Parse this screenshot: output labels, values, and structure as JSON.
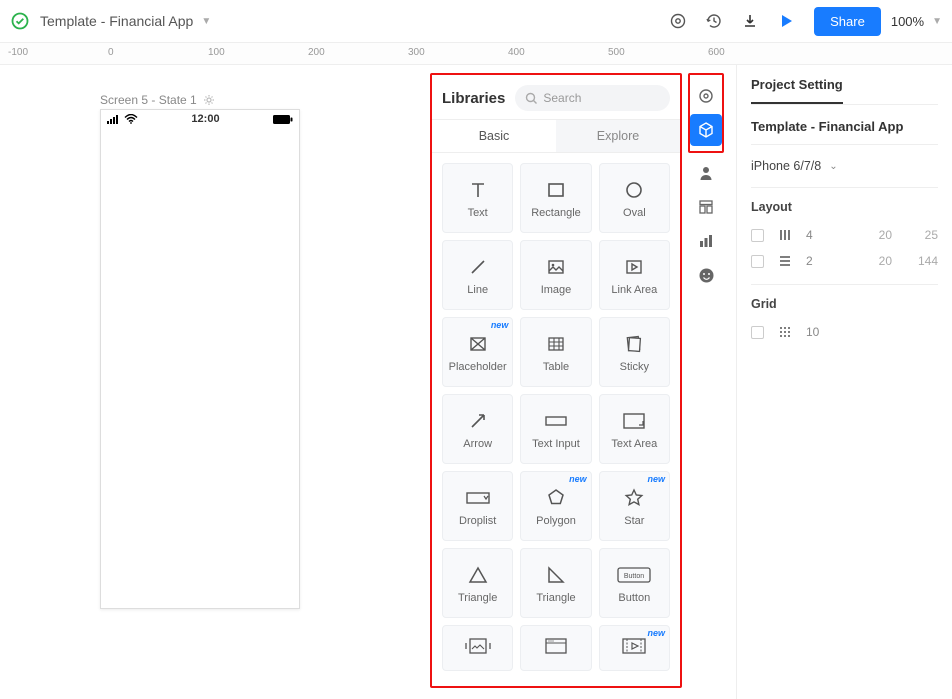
{
  "header": {
    "project_title": "Template - Financial App",
    "share_label": "Share",
    "zoom": "100%"
  },
  "ruler": {
    "ticks": [
      "-100",
      "0",
      "100",
      "200",
      "300",
      "400",
      "500",
      "600"
    ]
  },
  "canvas": {
    "screen_label": "Screen 5 - State 1",
    "phone_time": "12:00"
  },
  "libraries": {
    "title": "Libraries",
    "search_placeholder": "Search",
    "tabs": {
      "basic": "Basic",
      "explore": "Explore"
    },
    "items": [
      {
        "label": "Text",
        "icon": "text",
        "new": false
      },
      {
        "label": "Rectangle",
        "icon": "rect",
        "new": false
      },
      {
        "label": "Oval",
        "icon": "oval",
        "new": false
      },
      {
        "label": "Line",
        "icon": "line",
        "new": false
      },
      {
        "label": "Image",
        "icon": "image",
        "new": false
      },
      {
        "label": "Link Area",
        "icon": "linkarea",
        "new": false
      },
      {
        "label": "Placeholder",
        "icon": "placeholder",
        "new": true
      },
      {
        "label": "Table",
        "icon": "table",
        "new": false
      },
      {
        "label": "Sticky",
        "icon": "sticky",
        "new": false
      },
      {
        "label": "Arrow",
        "icon": "arrow",
        "new": false
      },
      {
        "label": "Text Input",
        "icon": "textinput",
        "new": false
      },
      {
        "label": "Text Area",
        "icon": "textarea",
        "new": false
      },
      {
        "label": "Droplist",
        "icon": "droplist",
        "new": false
      },
      {
        "label": "Polygon",
        "icon": "polygon",
        "new": true
      },
      {
        "label": "Star",
        "icon": "star",
        "new": true
      },
      {
        "label": "Triangle",
        "icon": "triangle",
        "new": false
      },
      {
        "label": "Triangle",
        "icon": "rtriangle",
        "new": false
      },
      {
        "label": "Button",
        "icon": "button",
        "new": false
      },
      {
        "label": "",
        "icon": "carousel",
        "new": false
      },
      {
        "label": "",
        "icon": "webpage",
        "new": false
      },
      {
        "label": "",
        "icon": "video",
        "new": true
      }
    ]
  },
  "right_panel": {
    "title": "Project Setting",
    "subtitle": "Template - Financial App",
    "device": "iPhone 6/7/8",
    "layout_label": "Layout",
    "layout_rows": [
      {
        "v1": "4",
        "v2": "20",
        "v3": "25"
      },
      {
        "v1": "2",
        "v2": "20",
        "v3": "144"
      }
    ],
    "grid_label": "Grid",
    "grid_value": "10"
  },
  "badge_text": "new",
  "button_badge_text": "Button"
}
